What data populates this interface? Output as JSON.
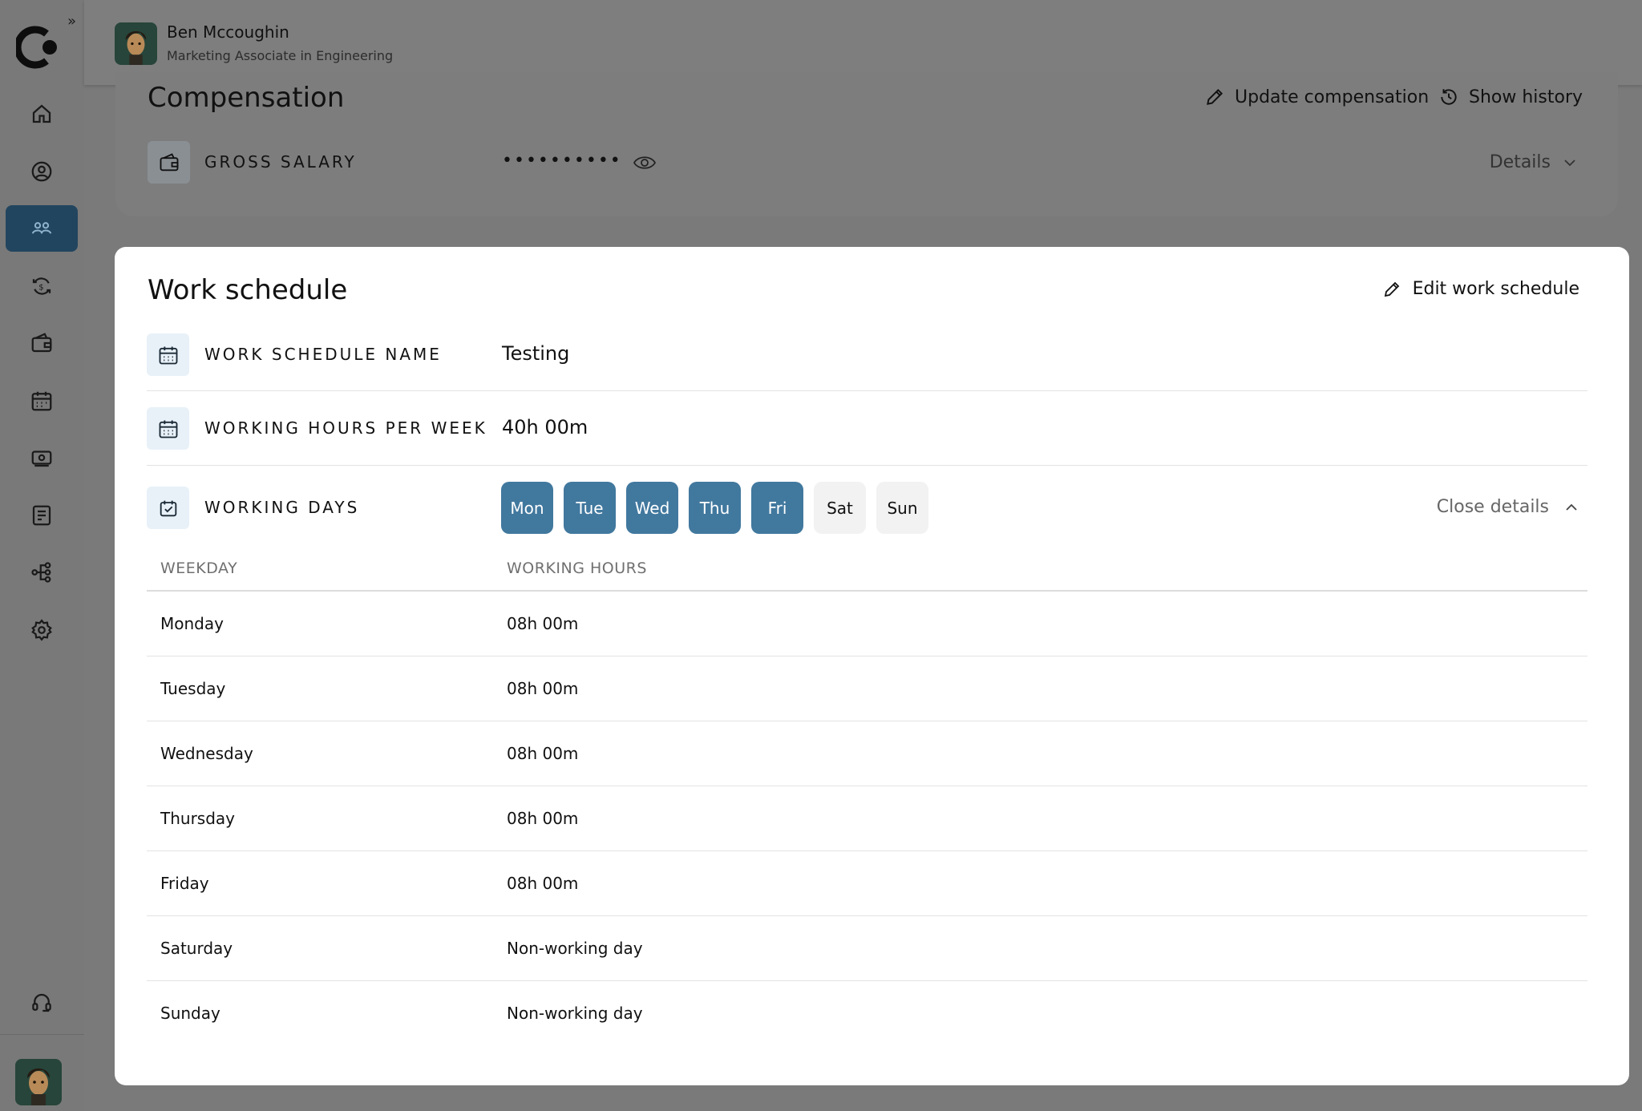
{
  "header": {
    "name": "Ben Mccoughin",
    "subtitle": "Marketing Associate in Engineering"
  },
  "sidebar": {
    "expand_glyph": "»",
    "items": [
      {
        "icon": "home-icon"
      },
      {
        "icon": "user-circle-icon"
      },
      {
        "icon": "people-icon",
        "active": true
      },
      {
        "icon": "currency-refresh-icon"
      },
      {
        "icon": "wallet-icon"
      },
      {
        "icon": "calendar-icon"
      },
      {
        "icon": "money-icon"
      },
      {
        "icon": "report-icon"
      },
      {
        "icon": "org-chart-icon"
      },
      {
        "icon": "gear-icon"
      }
    ],
    "support_icon": "headset-icon"
  },
  "compensation": {
    "title": "Compensation",
    "update_label": "Update compensation",
    "history_label": "Show history",
    "gross_salary_label": "GROSS SALARY",
    "gross_salary_value": "••••••••••",
    "details_label": "Details"
  },
  "work_schedule": {
    "title": "Work schedule",
    "edit_label": "Edit work schedule",
    "name_label": "WORK SCHEDULE NAME",
    "name_value": "Testing",
    "hours_label": "WORKING HOURS PER WEEK",
    "hours_value": "40h 00m",
    "days_label": "WORKING DAYS",
    "close_details_label": "Close details",
    "days": [
      {
        "label": "Mon",
        "active": true
      },
      {
        "label": "Tue",
        "active": true
      },
      {
        "label": "Wed",
        "active": true
      },
      {
        "label": "Thu",
        "active": true
      },
      {
        "label": "Fri",
        "active": true
      },
      {
        "label": "Sat",
        "active": false
      },
      {
        "label": "Sun",
        "active": false
      }
    ],
    "table": {
      "headers": [
        "WEEKDAY",
        "WORKING HOURS"
      ],
      "rows": [
        {
          "weekday": "Monday",
          "hours": "08h 00m"
        },
        {
          "weekday": "Tuesday",
          "hours": "08h 00m"
        },
        {
          "weekday": "Wednesday",
          "hours": "08h 00m"
        },
        {
          "weekday": "Thursday",
          "hours": "08h 00m"
        },
        {
          "weekday": "Friday",
          "hours": "08h 00m"
        },
        {
          "weekday": "Saturday",
          "hours": "Non-working day"
        },
        {
          "weekday": "Sunday",
          "hours": "Non-working day"
        }
      ]
    }
  },
  "colors": {
    "accent": "#41789e",
    "sidebar_active": "#22455f",
    "overlay": "#7a7a7a"
  }
}
